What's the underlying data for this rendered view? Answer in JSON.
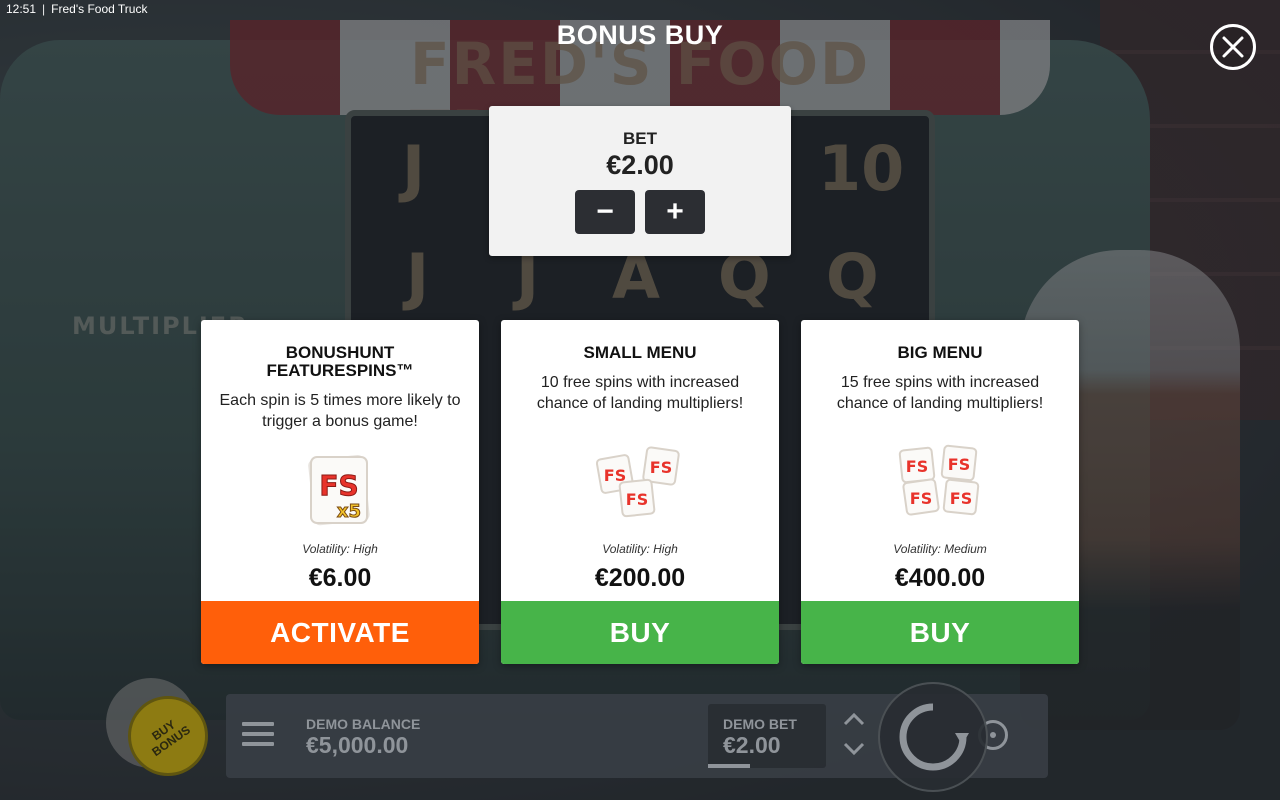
{
  "status_bar": {
    "time": "12:51",
    "separator": "|",
    "app_title": "Fred's Food Truck"
  },
  "game_background": {
    "logo_text": "FRED'S FOOD TRUCK",
    "multiplier_label": "MULTIPLIER",
    "reel_symbols": [
      "J",
      "10",
      "J",
      "J",
      "A",
      "Q",
      "Q"
    ]
  },
  "modal": {
    "title": "BONUS BUY",
    "close_icon": "close-icon"
  },
  "bet": {
    "label": "BET",
    "value": "€2.00",
    "decrease_label": "−",
    "increase_label": "+"
  },
  "cards": [
    {
      "title": "BONUSHUNT FEATURESPINS™",
      "description": "Each spin is 5 times more likely to trigger a bonus game!",
      "icon": "fs-x5-icon",
      "icon_text": "FS",
      "icon_sub": "x5",
      "volatility": "Volatility: High",
      "price": "€6.00",
      "action": "ACTIVATE",
      "action_color": "#ff5f0a"
    },
    {
      "title": "SMALL MENU",
      "description": "10 free spins with increased chance of landing multipliers!",
      "icon": "fs-three-icon",
      "icon_text": "FS",
      "volatility": "Volatility: High",
      "price": "€200.00",
      "action": "BUY",
      "action_color": "#47b449"
    },
    {
      "title": "BIG MENU",
      "description": "15 free spins with increased chance of landing multipliers!",
      "icon": "fs-four-icon",
      "icon_text": "FS",
      "volatility": "Volatility: Medium",
      "price": "€400.00",
      "action": "BUY",
      "action_color": "#47b449"
    }
  ],
  "bottom_bar": {
    "balance_label": "DEMO BALANCE",
    "balance_value": "€5,000.00",
    "bet_label": "DEMO BET",
    "bet_value": "€2.00",
    "buy_bonus_line1": "BUY",
    "buy_bonus_line2": "BONUS"
  }
}
